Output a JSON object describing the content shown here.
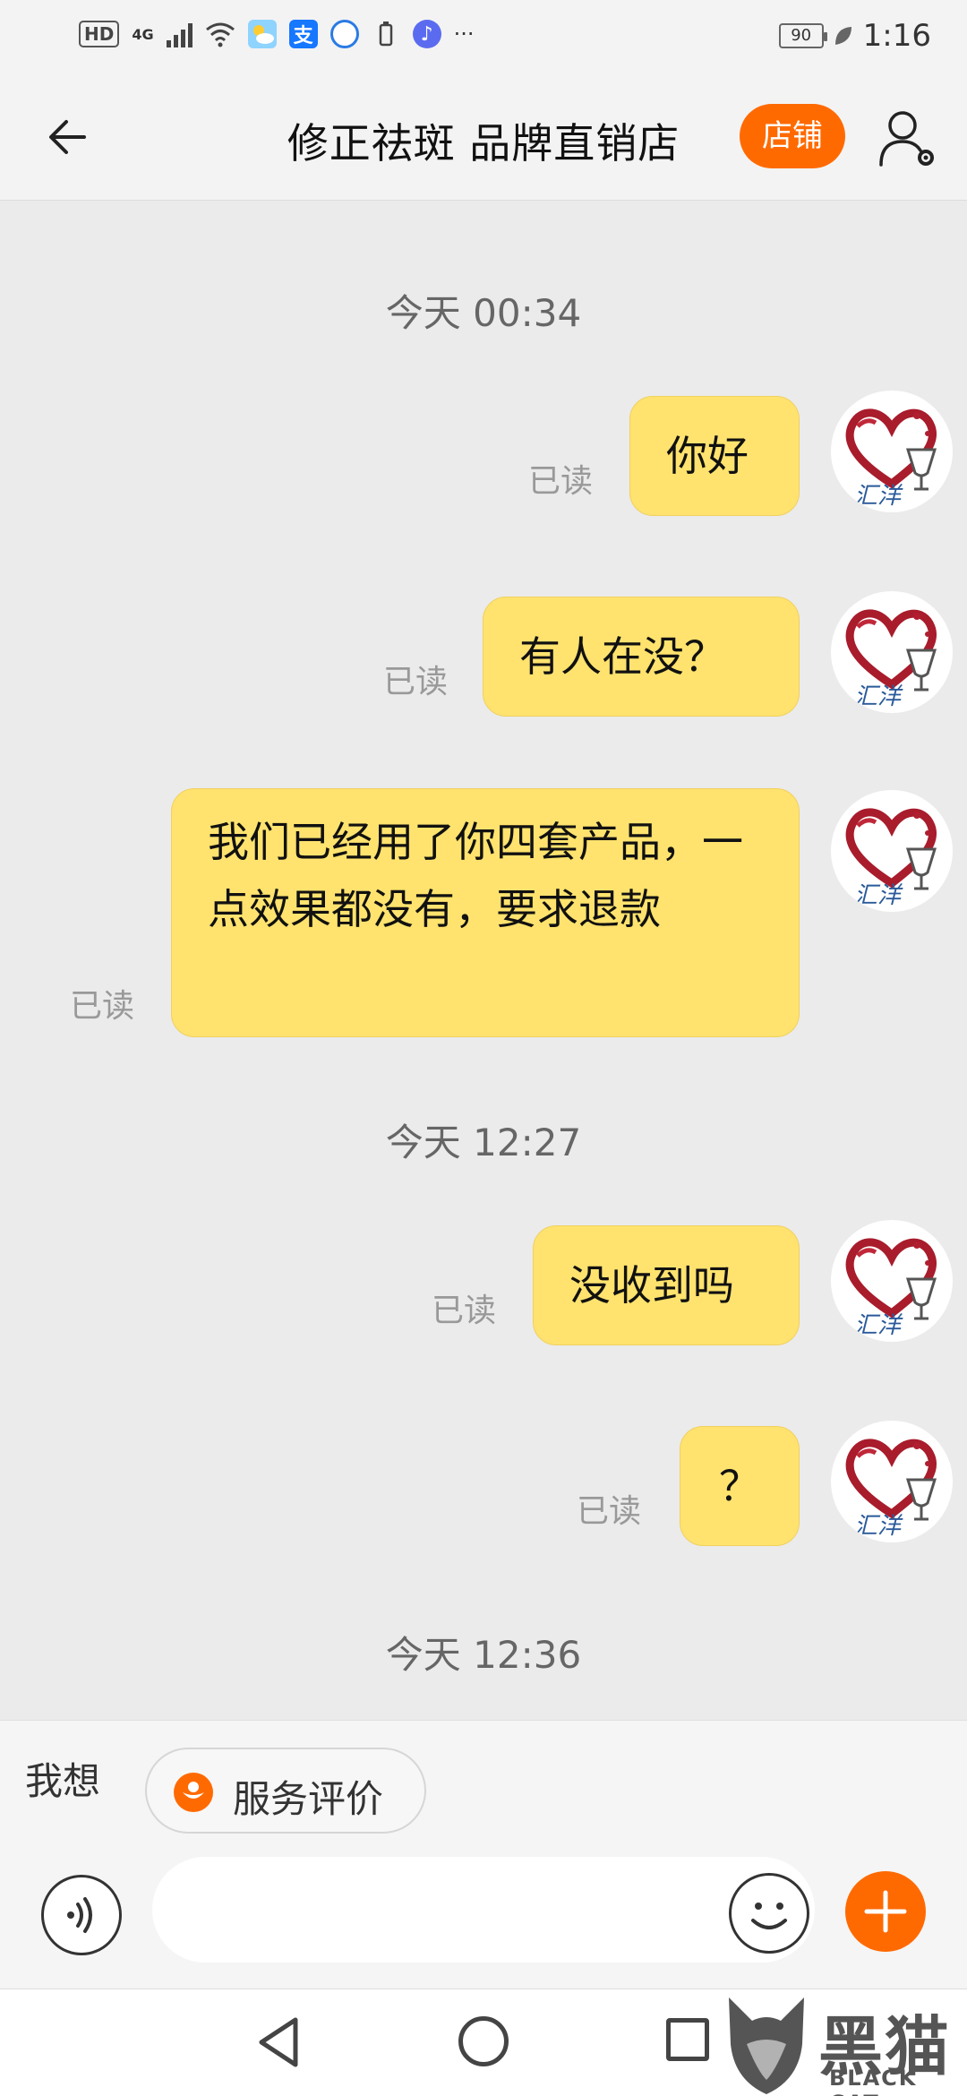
{
  "status_bar": {
    "hd": "HD",
    "network": "4G",
    "battery": "90",
    "time": "1:16",
    "alipay_glyph": "支",
    "more": "···"
  },
  "header": {
    "title": "修正祛斑 品牌直销店",
    "store_label": "店铺",
    "back_icon": "arrow-left",
    "profile_icon": "user-settings"
  },
  "messages": [
    {
      "type": "time",
      "text": "今天 00:34"
    },
    {
      "type": "msg",
      "text": "你好",
      "status": "已读"
    },
    {
      "type": "msg",
      "text": "有人在没？",
      "status": "已读"
    },
    {
      "type": "msg",
      "text": "我们已经用了你四套产品，一点效果都没有，要求退款",
      "status": "已读"
    },
    {
      "type": "time",
      "text": "今天 12:27"
    },
    {
      "type": "msg",
      "text": "没收到吗",
      "status": "已读"
    },
    {
      "type": "msg",
      "text": "？",
      "status": "已读"
    },
    {
      "type": "time",
      "text": "今天 12:36"
    }
  ],
  "avatar_text": "汇洋",
  "bottom": {
    "want_label": "我想",
    "chip_label": "服务评价",
    "input_value": "",
    "accent": "#ff6a00"
  },
  "watermark": {
    "cn": "黑猫",
    "en": "BLACK CAT"
  }
}
